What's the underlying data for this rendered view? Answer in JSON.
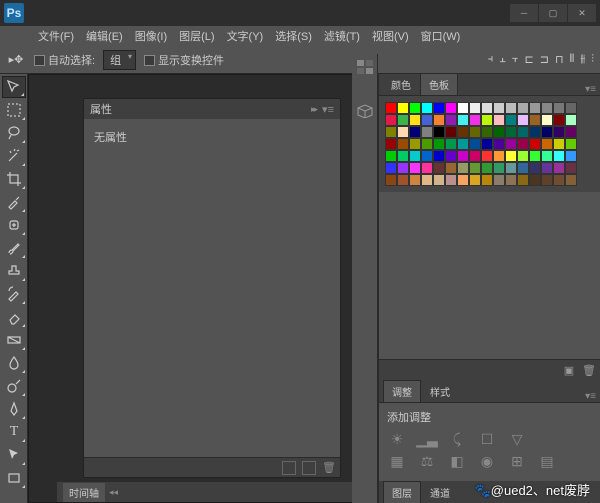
{
  "app": {
    "logo": "Ps"
  },
  "menus": [
    "文件(F)",
    "编辑(E)",
    "图像(I)",
    "图层(L)",
    "文字(Y)",
    "选择(S)",
    "滤镜(T)",
    "视图(V)",
    "窗口(W)"
  ],
  "options": {
    "auto_select_label": "自动选择:",
    "group_label": "组",
    "show_transform_label": "显示变换控件"
  },
  "panels": {
    "properties": {
      "title": "属性",
      "empty": "无属性"
    },
    "timeline": {
      "title": "时间轴"
    },
    "color": {
      "tab_color": "颜色",
      "tab_swatches": "色板"
    },
    "adjustments": {
      "tab_adjust": "调整",
      "tab_styles": "样式",
      "heading": "添加调整"
    },
    "layers": {
      "tab_layers": "图层",
      "tab_channels": "通道"
    }
  },
  "swatch_colors": [
    "#ff0000",
    "#ffff00",
    "#00ff00",
    "#00ffff",
    "#0000ff",
    "#ff00ff",
    "#ffffff",
    "#eeeeee",
    "#dddddd",
    "#cccccc",
    "#bbbbbb",
    "#aaaaaa",
    "#999999",
    "#888888",
    "#777777",
    "#666666",
    "#e6194b",
    "#3cb44b",
    "#ffe119",
    "#4363d8",
    "#f58231",
    "#911eb4",
    "#46f0f0",
    "#f032e6",
    "#bcf60c",
    "#fabebe",
    "#008080",
    "#e6beff",
    "#9a6324",
    "#fffac8",
    "#800000",
    "#aaffc3",
    "#808000",
    "#ffd8b1",
    "#000075",
    "#808080",
    "#000000",
    "#660000",
    "#663300",
    "#666600",
    "#336600",
    "#006600",
    "#006633",
    "#006666",
    "#003366",
    "#000066",
    "#330066",
    "#660066",
    "#990000",
    "#994c00",
    "#999900",
    "#4c9900",
    "#009900",
    "#00994c",
    "#009999",
    "#004c99",
    "#000099",
    "#4c0099",
    "#990099",
    "#99004c",
    "#cc0000",
    "#cc6600",
    "#cccc00",
    "#66cc00",
    "#00cc00",
    "#00cc66",
    "#00cccc",
    "#0066cc",
    "#0000cc",
    "#6600cc",
    "#cc00cc",
    "#cc0066",
    "#ff3333",
    "#ff9933",
    "#ffff33",
    "#99ff33",
    "#33ff33",
    "#33ff99",
    "#33ffff",
    "#3399ff",
    "#3333ff",
    "#9933ff",
    "#ff33ff",
    "#ff3399",
    "#663333",
    "#996633",
    "#999966",
    "#669933",
    "#339933",
    "#339966",
    "#669999",
    "#336699",
    "#333366",
    "#663399",
    "#993399",
    "#663344",
    "#8b4513",
    "#a0522d",
    "#cd853f",
    "#deb887",
    "#d2b48c",
    "#bc8f8f",
    "#f4a460",
    "#daa520",
    "#b8860b",
    "#8b7d6b",
    "#8b7355",
    "#8b6914",
    "#4a3520",
    "#5d4128",
    "#704d30",
    "#836038"
  ],
  "watermark": "🐾@ued2、net废脖"
}
